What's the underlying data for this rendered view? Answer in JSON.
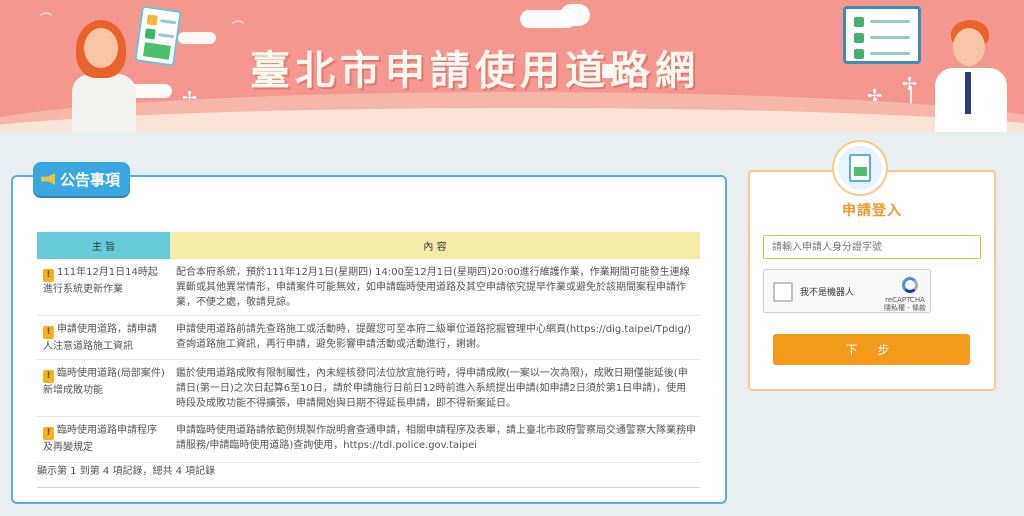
{
  "banner": {
    "title": "臺北市申請使用道路網"
  },
  "announcements": {
    "tag_label": "公告事項",
    "columns": {
      "subject": "主 旨",
      "content": "內 容"
    },
    "rows": [
      {
        "subject": "111年12月1日14時起進行系統更新作業",
        "content": "配合本府系統，預於111年12月1日(星期四) 14:00至12月1日(星期四)20:00進行維護作業，作業期間可能發生連線異斷或其他異常情形，申請案件可能無效，如申請臨時使用道路及其空申請依究提早作業或避免於該期間案程申請作業，不便之處，敬請見諒。"
      },
      {
        "subject": "申請使用道路，請申請人注意道路施工資訊",
        "content": "申請使用道路前請先查路施工或活動時，提醒您可至本府二級單位道路挖掘管理中心網頁(https://dig.taipei/Tpdig/)查詢道路施工資訊，再行申請，避免影響申請活動或活動進行，謝謝。"
      },
      {
        "subject": "臨時使用道路(局部案件)新增成敗功能",
        "content": "鑑於使用道路成敗有限制屬性，內未經核發同法位放宜施行時，得申請成敗(一案以一次為限)，成敗日期僅能延後(申請日(第一日)之次日起算6至10日，請於申請施行日前日12時前進入系統提出申請(如申請2日須於第1日申請)，使用時段及成敗功能不得擴張，申請開始與日期不得延長申請，即不得新案延日。"
      },
      {
        "subject": "臨時使用道路申請程序及再變規定",
        "content": "申請臨時使用道路請依範例規製作說明會查通申請，相關申請程序及表單，請上臺北市政府警察局交通警察大隊業務申請服務/申請臨時使用道路)查詢使用，https://tdl.police.gov.taipei"
      }
    ],
    "pager": "顯示第 1 到第 4 項記錄，總共 4 項記錄"
  },
  "login": {
    "title": "申請登入",
    "id_placeholder": "請輸入申請人身分證字號",
    "captcha_label": "我不是機器人",
    "captcha_brand": "reCAPTCHA",
    "captcha_links": "隱私權 - 條款",
    "next_label": "下 步"
  },
  "colors": {
    "banner": "#f4978e",
    "accent_blue": "#3ba7e0",
    "accent_orange": "#f39a1b",
    "warning_icon": "#f2b31c"
  }
}
